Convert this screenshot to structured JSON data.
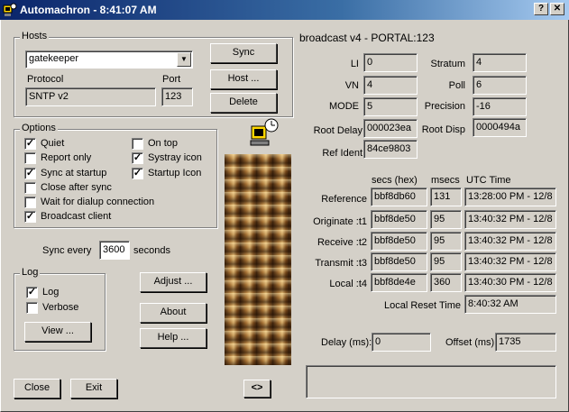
{
  "window": {
    "title": "Automachron - 8:41:07 AM",
    "help_glyph": "?",
    "close_glyph": "✕"
  },
  "hosts": {
    "legend": "Hosts",
    "selected_host": "gatekeeper",
    "protocol_label": "Protocol",
    "protocol_value": "SNTP v2",
    "port_label": "Port",
    "port_value": "123",
    "sync_button": "Sync",
    "host_button": "Host ...",
    "delete_button": "Delete"
  },
  "options": {
    "legend": "Options",
    "items": [
      {
        "label": "Quiet",
        "checked": true
      },
      {
        "label": "Report only",
        "checked": false
      },
      {
        "label": "Sync at startup",
        "checked": true
      },
      {
        "label": "Close after sync",
        "checked": false
      },
      {
        "label": "Wait for dialup connection",
        "checked": false
      },
      {
        "label": "Broadcast client",
        "checked": true
      },
      {
        "label": "On top",
        "checked": false
      },
      {
        "label": "Systray icon",
        "checked": true
      },
      {
        "label": "Startup Icon",
        "checked": true
      }
    ]
  },
  "sync": {
    "label": "Sync every",
    "value": "3600",
    "unit": "seconds"
  },
  "log": {
    "legend": "Log",
    "log_label": "Log",
    "log_checked": true,
    "verbose_label": "Verbose",
    "verbose_checked": false,
    "view_button": "View ..."
  },
  "buttons": {
    "adjust": "Adjust ...",
    "about": "About",
    "help": "Help ...",
    "close": "Close",
    "exit": "Exit",
    "toggle": "<>"
  },
  "ntp": {
    "header": "broadcast v4 - PORTAL:123",
    "li_label": "LI",
    "li": "0",
    "vn_label": "VN",
    "vn": "4",
    "mode_label": "MODE",
    "mode": "5",
    "root_delay_label": "Root Delay",
    "root_delay": "000023ea",
    "ref_ident_label": "Ref Ident",
    "ref_ident": "84ce9803",
    "stratum_label": "Stratum",
    "stratum": "4",
    "poll_label": "Poll",
    "poll": "6",
    "precision_label": "Precision",
    "precision": "-16",
    "root_disp_label": "Root Disp",
    "root_disp": "0000494a"
  },
  "timestamps": {
    "col_hex": "secs (hex)",
    "col_msecs": "msecs",
    "col_utc": "UTC Time",
    "rows": [
      {
        "label": "Reference",
        "hex": "bbf8db60",
        "msecs": "131",
        "utc": "13:28:00 PM - 12/8"
      },
      {
        "label": "Originate :t1",
        "hex": "bbf8de50",
        "msecs": "95",
        "utc": "13:40:32 PM - 12/8"
      },
      {
        "label": "Receive :t2",
        "hex": "bbf8de50",
        "msecs": "95",
        "utc": "13:40:32 PM - 12/8"
      },
      {
        "label": "Transmit :t3",
        "hex": "bbf8de50",
        "msecs": "95",
        "utc": "13:40:32 PM - 12/8"
      },
      {
        "label": "Local :t4",
        "hex": "bbf8de4e",
        "msecs": "360",
        "utc": "13:40:30 PM - 12/8"
      }
    ],
    "local_reset_label": "Local Reset Time",
    "local_reset": "8:40:32 AM",
    "delay_label": "Delay (ms):",
    "delay": "0",
    "offset_label": "Offset (ms):",
    "offset": "1735",
    "status": ""
  },
  "colors": {
    "face": "#d4d0c8",
    "title_start": "#0a246a",
    "title_end": "#a6caf0"
  }
}
